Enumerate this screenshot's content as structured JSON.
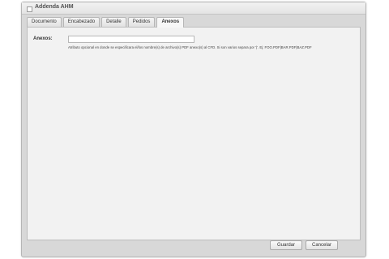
{
  "window": {
    "title": "Addenda AHM"
  },
  "tabs": [
    {
      "label": "Documento",
      "active": false
    },
    {
      "label": "Encabezado",
      "active": false
    },
    {
      "label": "Detalle",
      "active": false
    },
    {
      "label": "Pedidos",
      "active": false
    },
    {
      "label": "Anexos",
      "active": true
    }
  ],
  "form": {
    "anexos_label": "Anexos:",
    "anexos_value": "",
    "anexos_help": "Atributo opcional en donde se especificara el/los nombre(s) de archivo(s) PDF anexo(s) al CFD. Si son varios separa por '|'. Ej: FOO.PDF|BAR.PDF|BAZ.PDF"
  },
  "footer": {
    "save_label": "Guardar",
    "cancel_label": "Cancelar"
  }
}
